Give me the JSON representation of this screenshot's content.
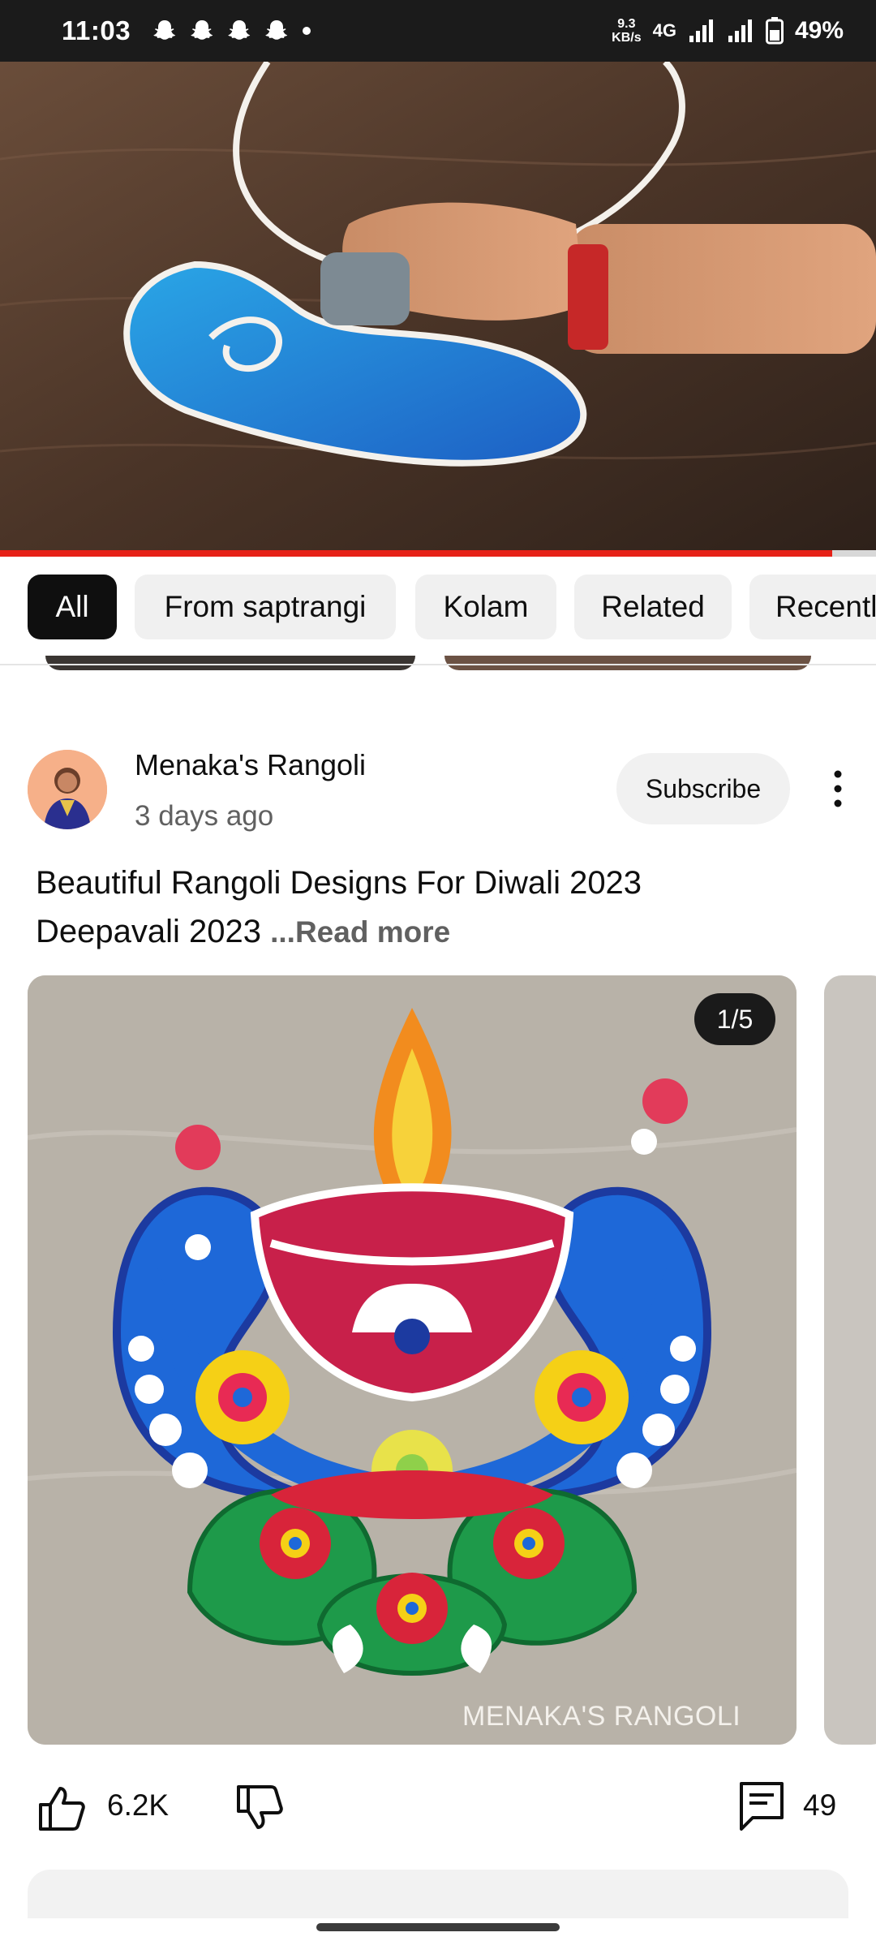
{
  "status_bar": {
    "time": "11:03",
    "net_speed_value": "9.3",
    "net_speed_unit": "KB/s",
    "network_type": "4G",
    "battery_percent": "49%",
    "icons": [
      "snapchat-icon",
      "snapchat-icon",
      "snapchat-icon",
      "snapchat-icon",
      "notification-dot",
      "signal-icon",
      "signal-icon",
      "battery-icon"
    ]
  },
  "video": {
    "progress_fraction": 0.95
  },
  "chips": [
    {
      "label": "All",
      "active": true
    },
    {
      "label": "From saptrangi",
      "active": false
    },
    {
      "label": "Kolam",
      "active": false
    },
    {
      "label": "Related",
      "active": false
    },
    {
      "label": "Recentl",
      "active": false
    }
  ],
  "post": {
    "channel_name": "Menaka's Rangoli",
    "time_ago": "3 days ago",
    "subscribe_label": "Subscribe",
    "text_line1": "Beautiful Rangoli Designs For Diwali 2023",
    "text_line2": "Deepavali 2023",
    "read_more": "...Read more",
    "image_counter": "1/5",
    "image_watermark": "MENAKA'S RANGOLI",
    "likes": "6.2K",
    "comments": "49"
  },
  "colors": {
    "accent_red": "#e62117",
    "chip_active_bg": "#0f0f0f",
    "chip_bg": "#f0f0f0",
    "secondary_text": "#606060"
  }
}
